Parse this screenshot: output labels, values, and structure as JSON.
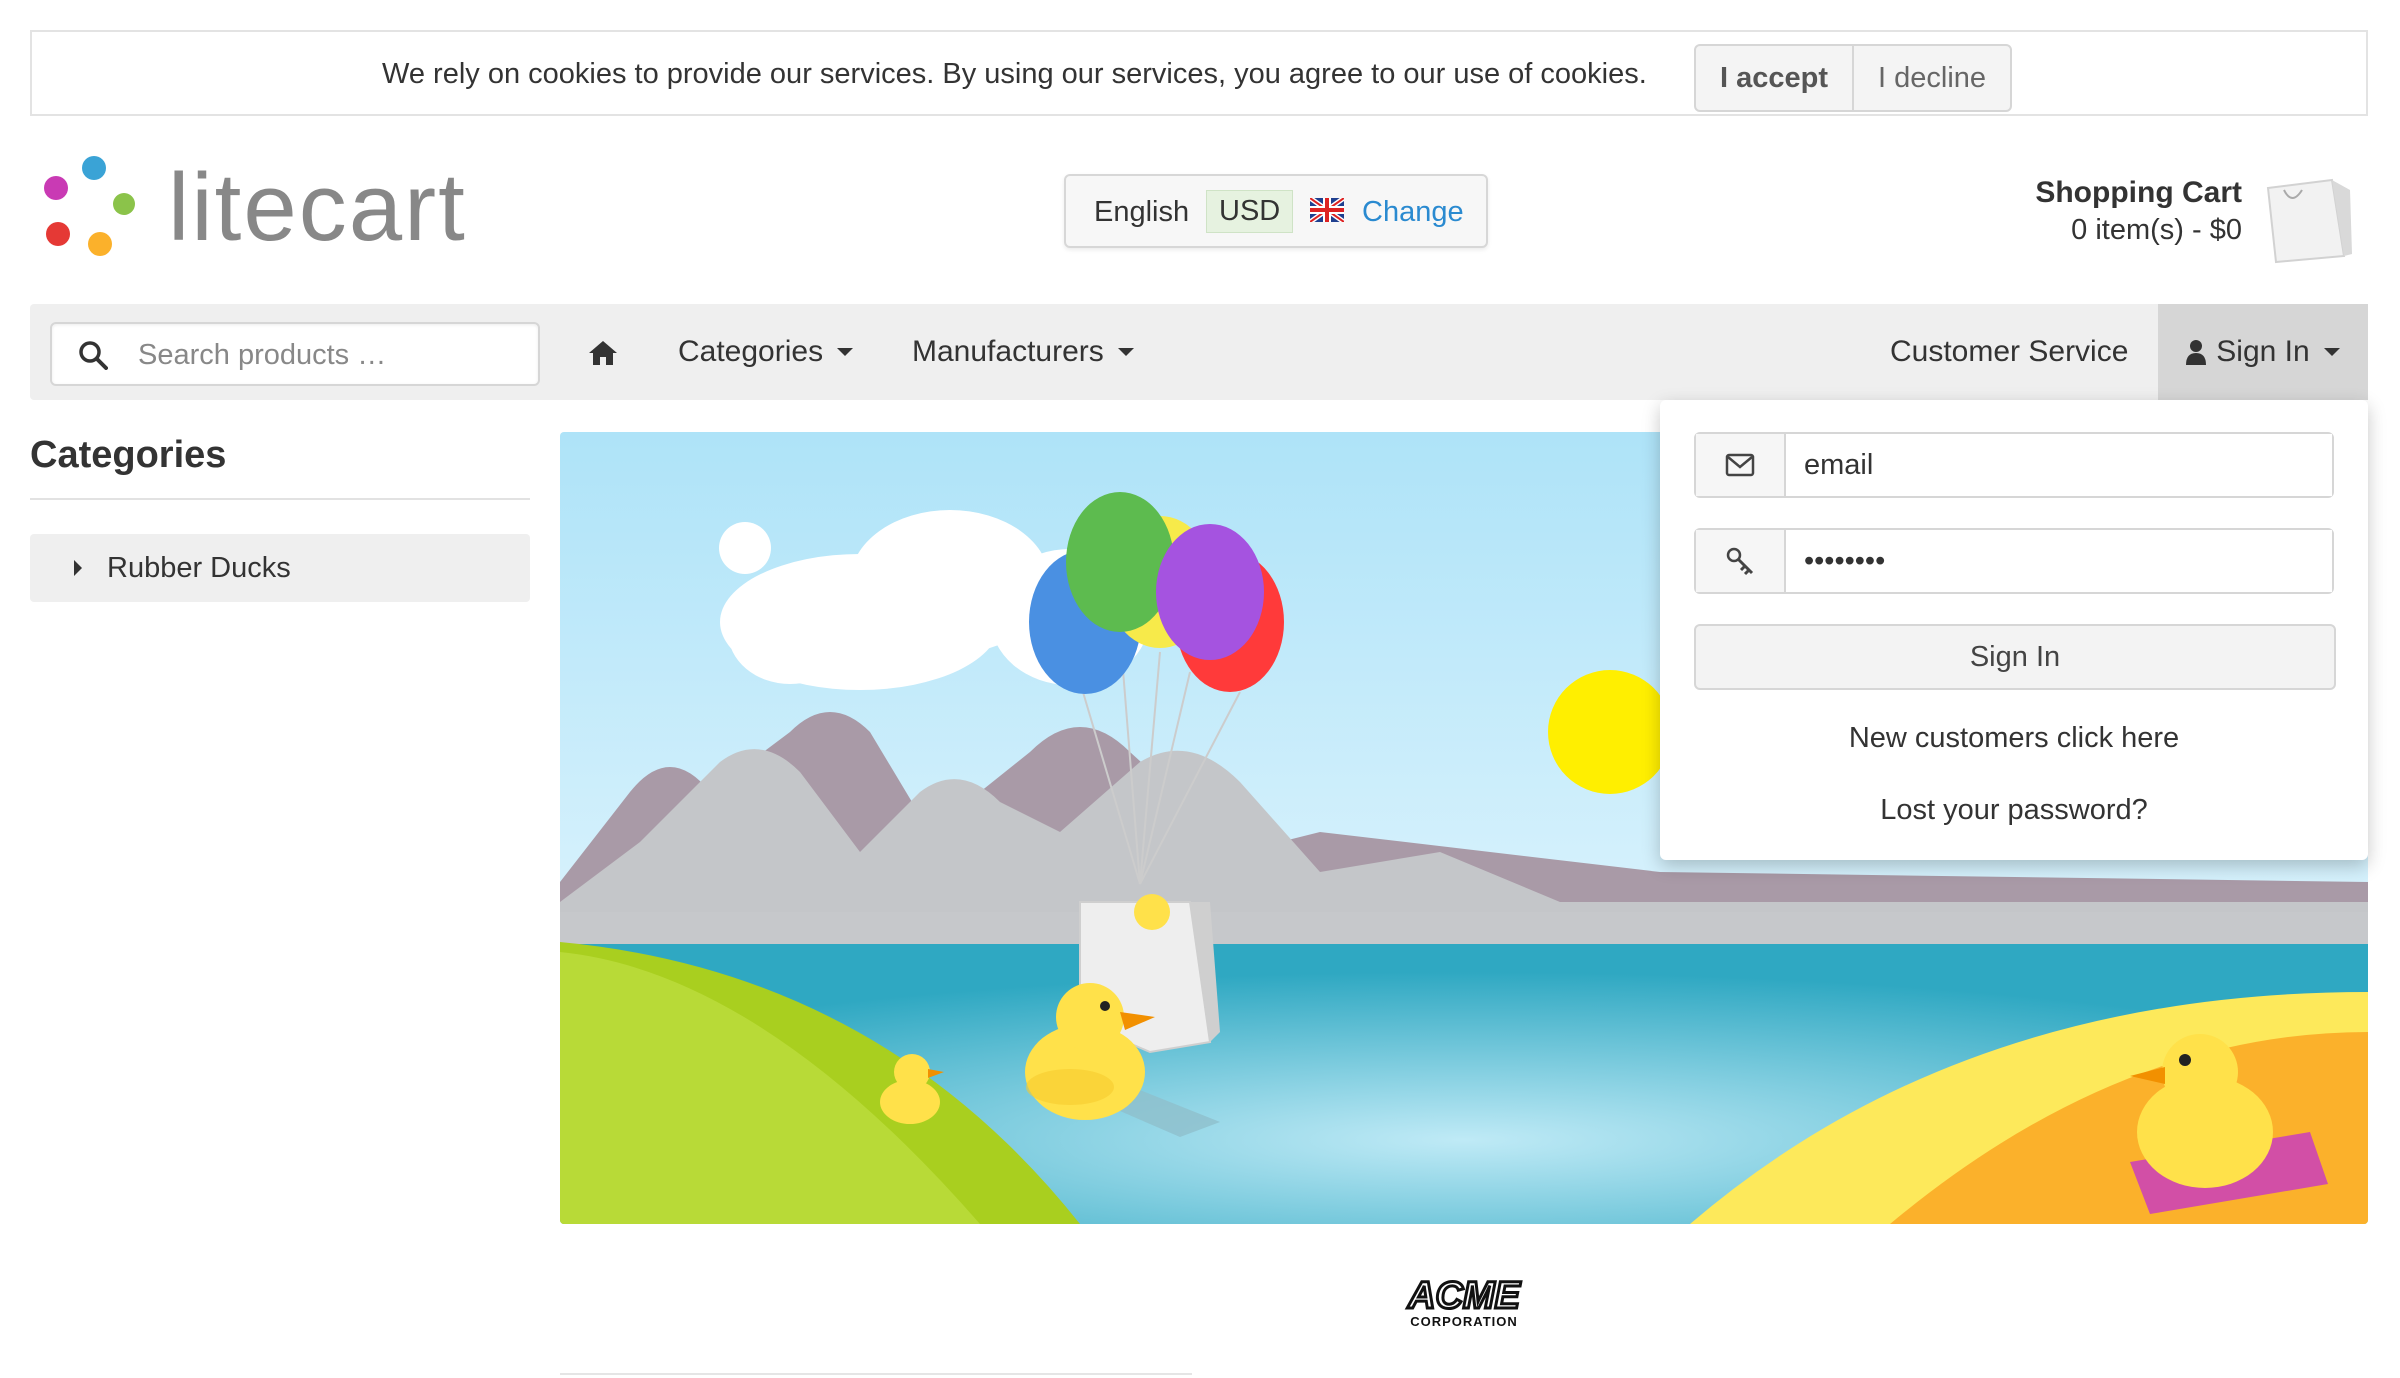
{
  "cookie_notice": {
    "text": "We rely on cookies to provide our services. By using our services, you agree to our use of cookies.",
    "accept_label": "I accept",
    "decline_label": "I decline"
  },
  "header": {
    "logo_text": "litecart",
    "language": "English",
    "currency": "USD",
    "change_label": "Change",
    "cart": {
      "title": "Shopping Cart",
      "summary": "0 item(s) - $0"
    }
  },
  "nav": {
    "search_placeholder": "Search products …",
    "categories_label": "Categories",
    "manufacturers_label": "Manufacturers",
    "customer_service_label": "Customer Service",
    "sign_in_label": "Sign In"
  },
  "sidebar": {
    "heading": "Categories",
    "items": [
      {
        "label": "Rubber Ducks"
      }
    ]
  },
  "signin_dropdown": {
    "email_value": "email",
    "password_value": "••••••••",
    "submit_label": "Sign In",
    "new_customers_label": "New customers click here",
    "lost_password_label": "Lost your password?"
  },
  "manufacturer_logo_text": "ACME CORPORATION",
  "colors": {
    "accent_link": "#2a8ad0",
    "navbar_bg": "#efefef",
    "signin_active_bg": "#d6d6d6"
  }
}
